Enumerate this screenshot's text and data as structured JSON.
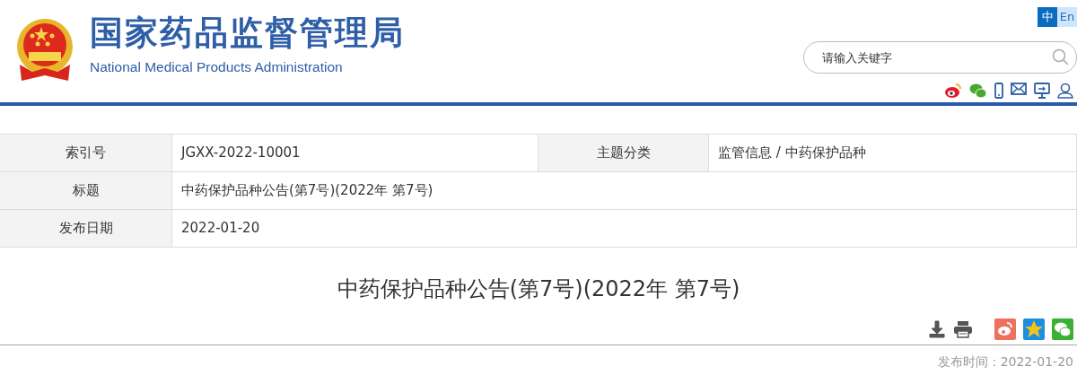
{
  "header": {
    "title": "国家药品监督管理局",
    "subtitle": "National Medical Products Administration"
  },
  "languages": [
    {
      "label": "中",
      "selected": true
    },
    {
      "label": "En",
      "selected": false
    }
  ],
  "search": {
    "placeholder": "请输入关键字"
  },
  "info_table": {
    "rows": [
      [
        {
          "kind": "label",
          "text": "索引号"
        },
        {
          "kind": "value",
          "text": "JGXX-2022-10001"
        },
        {
          "kind": "label",
          "text": "主题分类"
        },
        {
          "kind": "value",
          "text": "监管信息 / 中药保护品种"
        }
      ],
      [
        {
          "kind": "label",
          "text": "标题"
        },
        {
          "kind": "value",
          "text": "中药保护品种公告(第7号)(2022年 第7号)"
        }
      ],
      [
        {
          "kind": "label",
          "text": "发布日期"
        },
        {
          "kind": "value",
          "text": "2022-01-20"
        }
      ]
    ]
  },
  "article": {
    "title": "中药保护品种公告(第7号)(2022年 第7号)",
    "publish_time": "发布时间：2022-01-20"
  }
}
